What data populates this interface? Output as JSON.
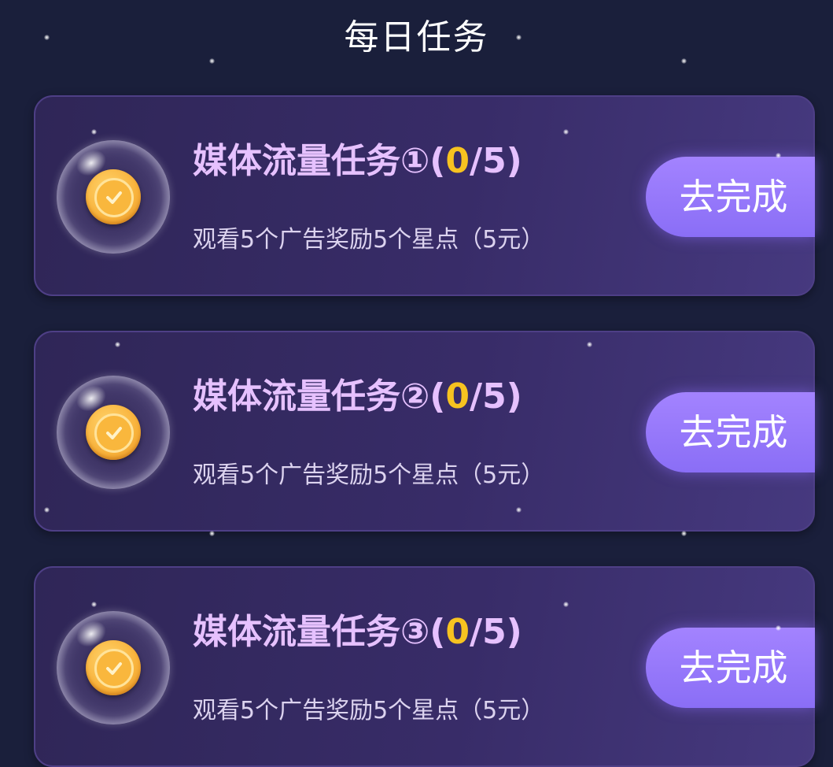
{
  "page": {
    "title": "每日任务"
  },
  "tasks": [
    {
      "title_prefix": "媒体流量任务①(",
      "current": "0",
      "title_suffix": "/5)",
      "description": "观看5个广告奖励5个星点（5元）",
      "button_label": "去完成",
      "icon": "coin-check-icon"
    },
    {
      "title_prefix": "媒体流量任务②(",
      "current": "0",
      "title_suffix": "/5)",
      "description": "观看5个广告奖励5个星点（5元）",
      "button_label": "去完成",
      "icon": "coin-check-icon"
    },
    {
      "title_prefix": "媒体流量任务③(",
      "current": "0",
      "title_suffix": "/5)",
      "description": "观看5个广告奖励5个星点（5元）",
      "button_label": "去完成",
      "icon": "coin-check-icon"
    }
  ],
  "colors": {
    "background": "#1a1f3b",
    "title_text": "#e6c1ff",
    "count_highlight": "#f7c320",
    "button": "#9a7cfb"
  }
}
